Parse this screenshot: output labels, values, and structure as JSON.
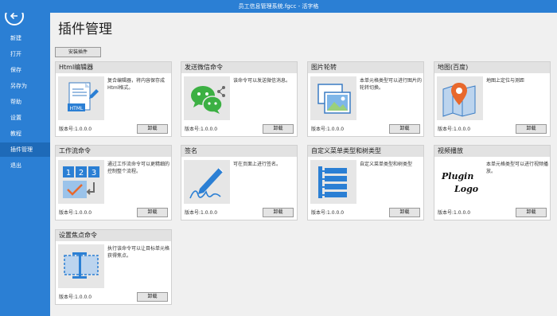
{
  "window": {
    "title": "员工信息管理系统.fgcc - 活字格"
  },
  "sidebar": {
    "items": [
      {
        "label": "新建"
      },
      {
        "label": "打开"
      },
      {
        "label": "保存"
      },
      {
        "label": "另存为"
      },
      {
        "label": "帮助"
      },
      {
        "label": "设置"
      },
      {
        "label": "教程"
      },
      {
        "label": "插件管理"
      },
      {
        "label": "退出"
      }
    ]
  },
  "main": {
    "title": "插件管理",
    "install_label": "安装插件",
    "plugins": [
      {
        "name": "Html编辑器",
        "desc": "复合编辑器，将内容保存成Html格式。",
        "version": "版本号:1.0.0.0",
        "uninstall": "卸载",
        "icon": "html-editor-icon"
      },
      {
        "name": "发送微信命令",
        "desc": "该命令可以发送微信消息。",
        "version": "版本号:1.0.0.0",
        "uninstall": "卸载",
        "icon": "wechat-icon"
      },
      {
        "name": "图片轮转",
        "desc": "本单元格类型可以进行图片的轮转切换。",
        "version": "版本号:1.0.0.0",
        "uninstall": "卸载",
        "icon": "image-carousel-icon"
      },
      {
        "name": "地图(百度)",
        "desc": "地图上定位与测距",
        "version": "版本号:1.0.0.0",
        "uninstall": "卸载",
        "icon": "map-pin-icon"
      },
      {
        "name": "工作流命令",
        "desc": "通过工作流命令可以更精细的控制整个流程。",
        "version": "版本号:1.0.0.0",
        "uninstall": "卸载",
        "icon": "workflow-icon"
      },
      {
        "name": "签名",
        "desc": "可在页面上进行签名。",
        "version": "版本号:1.0.0.0",
        "uninstall": "卸载",
        "icon": "signature-icon"
      },
      {
        "name": "自定义菜单类型和树类型",
        "desc": "自定义菜单类型和树类型",
        "version": "版本号:1.0.0.0",
        "uninstall": "卸载",
        "icon": "menu-tree-icon"
      },
      {
        "name": "视频播放",
        "desc": "本单元格类型可以进行视频播放。",
        "version": "版本号:1.0.0.0",
        "uninstall": "卸载",
        "icon": "plugin-logo-icon",
        "logo_text": [
          "Plugin",
          "Logo"
        ]
      },
      {
        "name": "设置焦点命令",
        "desc": "执行该命令可以让目标单元格获得焦点。",
        "version": "版本号:1.0.0.0",
        "uninstall": "卸载",
        "icon": "focus-icon"
      }
    ]
  },
  "colors": {
    "accent": "#2b7fd4",
    "accent_active": "#1e6ab8"
  }
}
